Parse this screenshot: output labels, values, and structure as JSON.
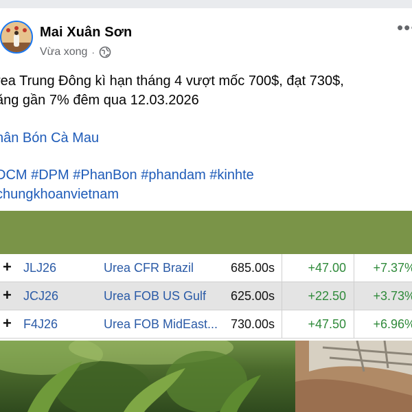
{
  "post": {
    "author": "Mai Xuân Sơn",
    "time": "Vừa xong",
    "privacy_icon": "globe-icon",
    "text_line1": "rea Trung Đông kì hạn tháng 4 vượt mốc 700$, đạt 730$,",
    "text_line2": "ăng gần 7% đêm qua 12.03.2026",
    "page_link": "hân Bón Cà Mau",
    "hashtags_line1": "DCM #DPM #PhanBon #phandam #kinhte",
    "hashtags_line2": "chungkhoanvietnam"
  },
  "market": {
    "rows": [
      {
        "symbol": "JLJ26",
        "name": "Urea CFR Brazil",
        "price": "685.00s",
        "change": "+47.00",
        "percent": "+7.37%"
      },
      {
        "symbol": "JCJ26",
        "name": "Urea FOB US Gulf",
        "price": "625.00s",
        "change": "+22.50",
        "percent": "+3.73%"
      },
      {
        "symbol": "F4J26",
        "name": "Urea FOB MidEast...",
        "price": "730.00s",
        "change": "+47.50",
        "percent": "+6.96%"
      }
    ],
    "expand_symbol": "+"
  },
  "colors": {
    "link": "#1e5bb8",
    "positive": "#2f8a3a",
    "header_bar": "#7a9448"
  }
}
